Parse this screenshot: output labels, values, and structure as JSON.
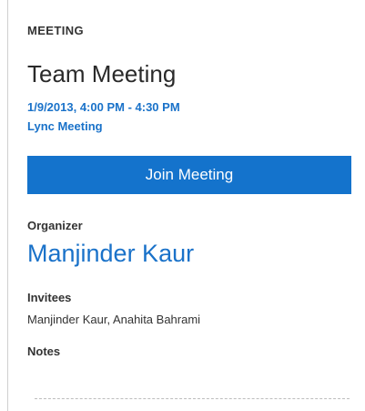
{
  "header": {
    "section": "MEETING"
  },
  "meeting": {
    "title": "Team Meeting",
    "datetime": "1/9/2013, 4:00 PM - 4:30 PM",
    "type": "Lync Meeting",
    "join_label": "Join Meeting"
  },
  "organizer": {
    "label": "Organizer",
    "name": "Manjinder Kaur"
  },
  "invitees": {
    "label": "Invitees",
    "value": "Manjinder Kaur, Anahita Bahrami"
  },
  "notes": {
    "label": "Notes"
  },
  "colors": {
    "accent": "#1a72c9",
    "button": "#1473cc"
  }
}
